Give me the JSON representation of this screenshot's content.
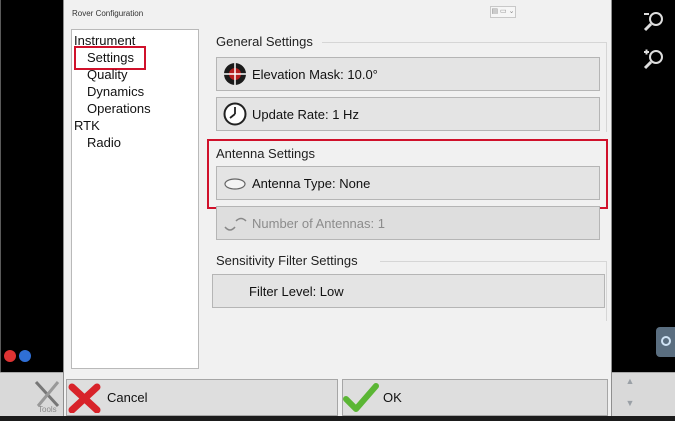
{
  "dialog": {
    "title": "Rover Configuration"
  },
  "tree": [
    {
      "label": "Instrument"
    },
    {
      "label": "Settings"
    },
    {
      "label": "Quality"
    },
    {
      "label": "Dynamics"
    },
    {
      "label": "Operations"
    },
    {
      "label": "RTK"
    },
    {
      "label": "Radio"
    }
  ],
  "general": {
    "title": "General Settings",
    "elevation_mask": "Elevation Mask: 10.0°",
    "update_rate": "Update Rate: 1 Hz"
  },
  "antenna": {
    "title": "Antenna Settings",
    "antenna_type": "Antenna Type: None",
    "num_antennas": "Number of Antennas: 1"
  },
  "sensitivity": {
    "title": "Sensitivity Filter Settings",
    "filter_level": "Filter Level: Low"
  },
  "actions": {
    "cancel": "Cancel",
    "ok": "OK"
  },
  "background": {
    "tools_label": "Tools"
  },
  "colors": {
    "highlight": "#d0112b",
    "panel": "#f1f1f1",
    "button": "#e4e4e4"
  }
}
